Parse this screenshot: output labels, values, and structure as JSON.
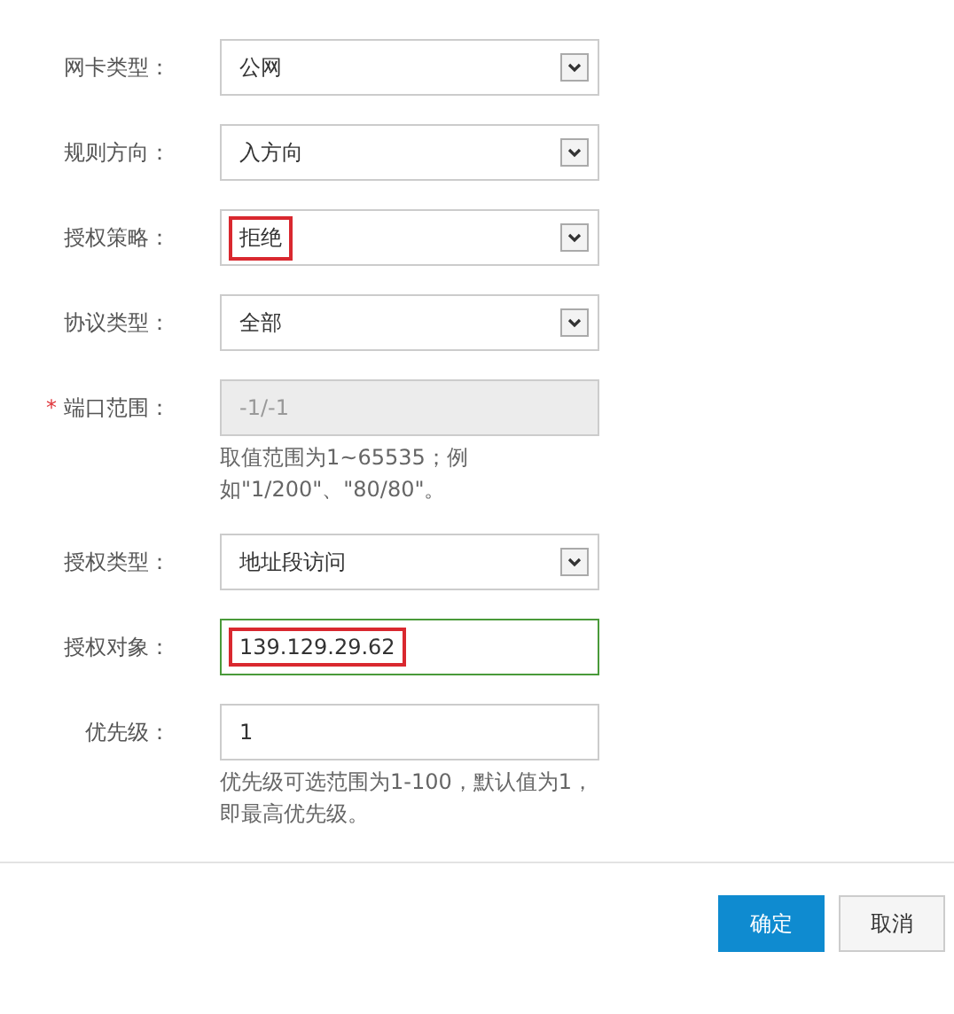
{
  "form": {
    "fields": [
      {
        "label": "网卡类型：",
        "kind": "select",
        "value": "公网",
        "disabled": false,
        "focused": false,
        "highlighted": false
      },
      {
        "label": "规则方向：",
        "kind": "select",
        "value": "入方向",
        "disabled": false,
        "focused": false,
        "highlighted": false
      },
      {
        "label": "授权策略：",
        "kind": "select",
        "value": "拒绝",
        "disabled": false,
        "focused": false,
        "highlighted": true
      },
      {
        "label": "协议类型：",
        "kind": "select",
        "value": "全部",
        "disabled": false,
        "focused": false,
        "highlighted": false
      },
      {
        "label": "端口范围：",
        "kind": "input",
        "placeholder": "-1/-1",
        "required_mark": "*",
        "disabled": true,
        "focused": false,
        "highlighted": false,
        "hint": "取值范围为1~65535；例如\"1/200\"、\"80/80\"。"
      },
      {
        "label": "授权类型：",
        "kind": "select",
        "value": "地址段访问",
        "disabled": false,
        "focused": false,
        "highlighted": false
      },
      {
        "label": "授权对象：",
        "kind": "input",
        "value": "139.129.29.62",
        "disabled": false,
        "focused": true,
        "highlighted": true
      },
      {
        "label": "优先级：",
        "kind": "input",
        "value": "1",
        "disabled": false,
        "focused": false,
        "highlighted": false,
        "hint": "优先级可选范围为1-100，默认值为1，即最高优先级。"
      }
    ]
  },
  "footer": {
    "buttons": [
      {
        "label": "确定",
        "kind": "primary"
      },
      {
        "label": "取消",
        "kind": "secondary"
      }
    ]
  }
}
